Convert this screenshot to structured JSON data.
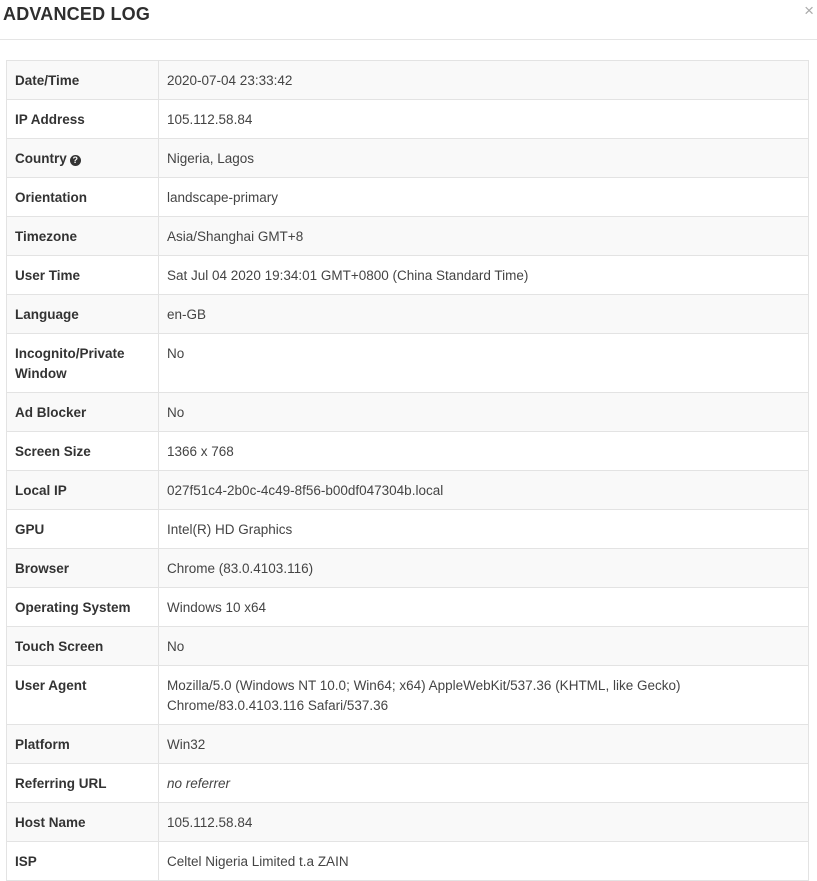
{
  "modal": {
    "title": "ADVANCED LOG",
    "close_label": "×"
  },
  "rows": [
    {
      "label": "Date/Time",
      "value": "2020-07-04 23:33:42"
    },
    {
      "label": "IP Address",
      "value": "105.112.58.84"
    },
    {
      "label": "Country",
      "value": "Nigeria, Lagos",
      "help_icon": "question-circle-icon",
      "help_glyph": "?"
    },
    {
      "label": "Orientation",
      "value": "landscape-primary"
    },
    {
      "label": "Timezone",
      "value": "Asia/Shanghai GMT+8"
    },
    {
      "label": "User Time",
      "value": "Sat Jul 04 2020 19:34:01 GMT+0800 (China Standard Time)"
    },
    {
      "label": "Language",
      "value": "en-GB"
    },
    {
      "label": "Incognito/Private Window",
      "value": "No"
    },
    {
      "label": "Ad Blocker",
      "value": "No"
    },
    {
      "label": "Screen Size",
      "value": "1366 x 768"
    },
    {
      "label": "Local IP",
      "value": "027f51c4-2b0c-4c49-8f56-b00df047304b.local"
    },
    {
      "label": "GPU",
      "value": "Intel(R) HD Graphics"
    },
    {
      "label": "Browser",
      "value": "Chrome (83.0.4103.116)"
    },
    {
      "label": "Operating System",
      "value": "Windows 10 x64"
    },
    {
      "label": "Touch Screen",
      "value": "No"
    },
    {
      "label": "User Agent",
      "value": "Mozilla/5.0 (Windows NT 10.0; Win64; x64) AppleWebKit/537.36 (KHTML, like Gecko) Chrome/83.0.4103.116 Safari/537.36"
    },
    {
      "label": "Platform",
      "value": "Win32"
    },
    {
      "label": "Referring URL",
      "value": "no referrer",
      "muted": true
    },
    {
      "label": "Host Name",
      "value": "105.112.58.84"
    },
    {
      "label": "ISP",
      "value": "Celtel Nigeria Limited t.a ZAIN"
    }
  ]
}
